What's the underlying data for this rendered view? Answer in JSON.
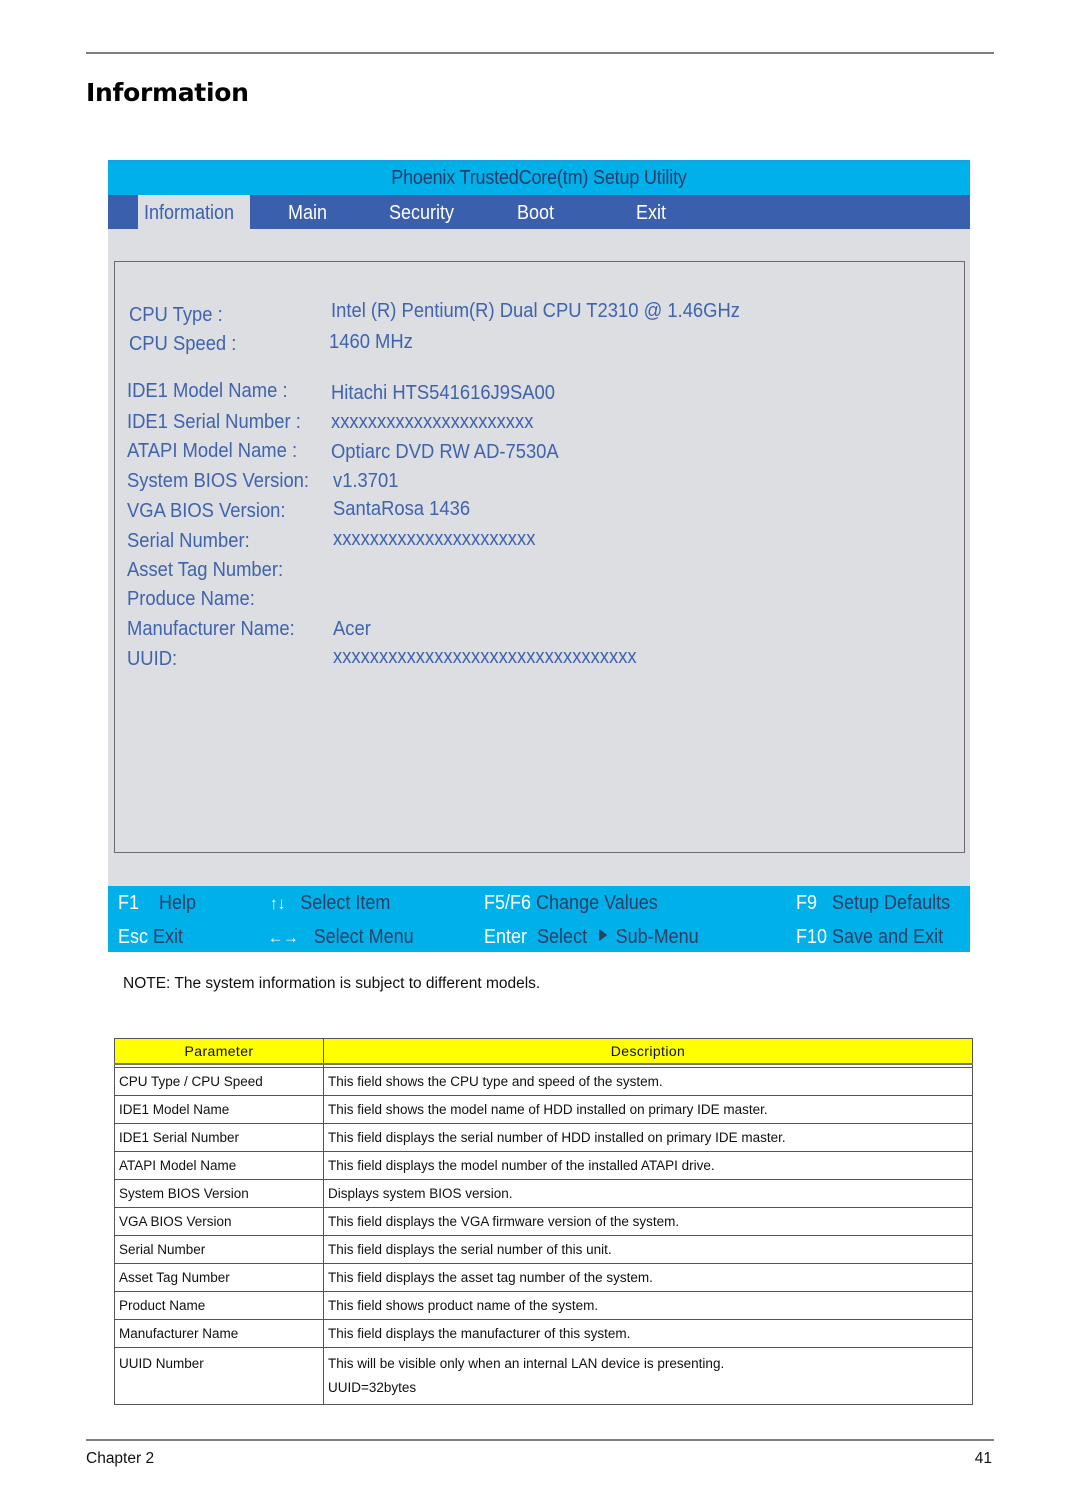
{
  "page": {
    "title": "Information",
    "footer_chapter": "Chapter 2",
    "footer_page": "41"
  },
  "bios": {
    "utility_title": "Phoenix TrustedCore(tm) Setup Utility",
    "menu": [
      {
        "label": "Information",
        "active": true
      },
      {
        "label": "Main",
        "active": false
      },
      {
        "label": "Security",
        "active": false
      },
      {
        "label": "Boot",
        "active": false
      },
      {
        "label": "Exit",
        "active": false
      }
    ],
    "fields": [
      {
        "label": "CPU Type :",
        "value": "Intel (R)  Pentium(R) Dual CPU T2310 @ 1.46GHz"
      },
      {
        "label": "CPU Speed :",
        "value": "1460 MHz"
      },
      {
        "label": "IDE1 Model Name :",
        "value": "Hitachi HTS541616J9SA00"
      },
      {
        "label": "IDE1 Serial Number :",
        "value": "xxxxxxxxxxxxxxxxxxxxxx"
      },
      {
        "label": "ATAPI Model Name :",
        "value": "Optiarc DVD RW AD-7530A"
      },
      {
        "label": "System BIOS Version:",
        "value": "v1.3701"
      },
      {
        "label": "VGA BIOS Version:",
        "value": "SantaRosa 1436"
      },
      {
        "label": "Serial Number:",
        "value": "xxxxxxxxxxxxxxxxxxxxxx"
      },
      {
        "label": "Asset Tag Number:",
        "value": ""
      },
      {
        "label": "Produce Name:",
        "value": ""
      },
      {
        "label": "Manufacturer Name:",
        "value": "Acer"
      },
      {
        "label": "UUID:",
        "value": "xxxxxxxxxxxxxxxxxxxxxxxxxxxxxxxxx"
      }
    ],
    "footer_keys": {
      "f1_key": "F1",
      "f1_desc": "Help",
      "esc_key": "Esc",
      "esc_desc": "Exit",
      "updown_icon": "↑↓",
      "updown_desc": "Select Item",
      "leftright_icon": "←→",
      "leftright_desc": "Select Menu",
      "f5f6_key": "F5/F6",
      "f5f6_desc": "Change Values",
      "enter_key": "Enter",
      "enter_desc": "Select",
      "submenu_desc": "Sub-Menu",
      "f9_key": "F9",
      "f9_desc": "Setup Defaults",
      "f10_key": "F10",
      "f10_desc": "Save and Exit"
    },
    "colors": {
      "title_bar": "#00b0e8",
      "menu_bar": "#3a5fac",
      "panel_bg": "#dcdee2",
      "text_blue": "#3f63ad"
    }
  },
  "note": "NOTE: The system information is subject to different models.",
  "table": {
    "headers": [
      "Parameter",
      "Description"
    ],
    "rows": [
      {
        "param": "CPU Type / CPU Speed",
        "desc": "This field shows the CPU type and speed of the system."
      },
      {
        "param": "IDE1 Model Name",
        "desc": "This field shows the model name of HDD installed on primary IDE master."
      },
      {
        "param": "IDE1 Serial Number",
        "desc": "This field displays the serial number of HDD installed on primary IDE master."
      },
      {
        "param": "ATAPI Model Name",
        "desc": "This field displays the model number of the installed ATAPI drive."
      },
      {
        "param": "System BIOS Version",
        "desc": "Displays system BIOS version."
      },
      {
        "param": "VGA BIOS Version",
        "desc": "This field displays the VGA firmware version of the system."
      },
      {
        "param": "Serial Number",
        "desc": "This field displays the serial number of this unit."
      },
      {
        "param": "Asset Tag Number",
        "desc": "This field displays the asset tag number of the system."
      },
      {
        "param": "Product Name",
        "desc": "This field shows product name of the system."
      },
      {
        "param": "Manufacturer Name",
        "desc": "This field displays the manufacturer of this system."
      },
      {
        "param": "UUID Number",
        "desc": "This will be visible only when an internal LAN device is presenting.",
        "desc2": "UUID=32bytes"
      }
    ]
  }
}
